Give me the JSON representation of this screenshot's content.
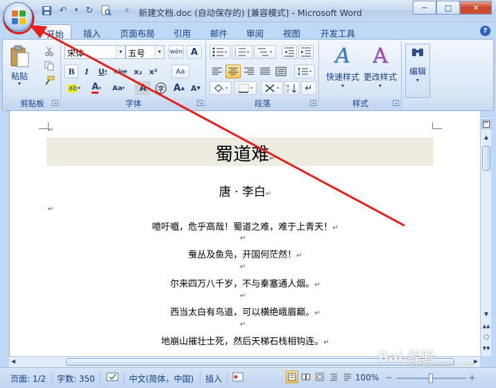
{
  "window": {
    "title": "新建文档.doc (自动保存的) [兼容模式] - Microsoft Word",
    "minimize": "─",
    "maximize": "□",
    "close": "✕"
  },
  "qat": {
    "save": "💾",
    "undo": "↶",
    "undo_dd": "▾",
    "redo": "↻",
    "print_preview": "🔍",
    "customize": "▿"
  },
  "tabs": [
    "开始",
    "插入",
    "页面布局",
    "引用",
    "邮件",
    "审阅",
    "视图",
    "开发工具"
  ],
  "help": "?",
  "ribbon": {
    "clipboard": {
      "label": "剪贴板",
      "paste": "粘贴",
      "paste_arrow": "▾"
    },
    "font": {
      "label": "字体",
      "font_name": "宋体",
      "font_size": "五号",
      "grow": "A",
      "ruby": "wén",
      "bold": "B",
      "italic": "I",
      "underline": "U",
      "strike": "abe",
      "subscript": "x₂",
      "superscript": "x²",
      "clear_format": "Aa",
      "highlight": "ab",
      "font_color": "A",
      "change_case": "Aa",
      "char_shading": "A",
      "enclose": "字",
      "grow_font": "A",
      "shrink_font": "A"
    },
    "paragraph": {
      "label": "段落"
    },
    "styles": {
      "label": "样式",
      "quick_styles": "快速样式",
      "change_styles": "更改样式",
      "quick_icon": "A",
      "change_icon": "A"
    },
    "editing": {
      "label": "编辑",
      "edit": "编辑",
      "icon": "A"
    }
  },
  "document": {
    "empty_mark": "↵",
    "title": "蜀道难",
    "author": "唐 · 李白",
    "lines": [
      "噫吁嚱，危乎高哉！蜀道之难，难于上青天！",
      "蚕丛及鱼凫，开国何茫然！",
      "尔来四万八千岁，不与秦塞通人烟。",
      "西当太白有鸟道，可以横绝峨眉巅。",
      "地崩山摧壮士死，然后天梯石栈相钩连。"
    ]
  },
  "statusbar": {
    "page": "页面: 1/2",
    "words": "字数: 350",
    "language": "中文(简体，中国)",
    "insert": "插入",
    "zoom": "100%",
    "zoom_minus": "－",
    "zoom_plus": "＋"
  },
  "annotation": {
    "watermark": "Bai 经验",
    "watermark_sub": "jingyan.baidu.com",
    "highlight_color": "#e8201d"
  }
}
